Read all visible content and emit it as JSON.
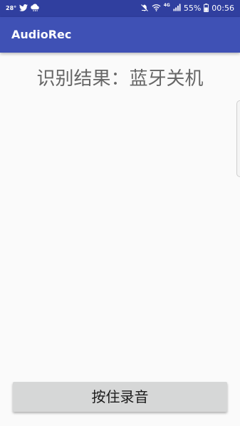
{
  "status_bar": {
    "temperature": "28°",
    "left_icons": [
      "twitter-icon",
      "cloud-rain-icon"
    ],
    "right_icons": [
      "mute-icon",
      "wifi-icon",
      "signal-icon",
      "battery-icon"
    ],
    "network_label": "4G",
    "battery_percent": "55%",
    "time": "00:56"
  },
  "app_bar": {
    "title": "AudioRec",
    "color": "#3f51b5",
    "status_color": "#303f9f"
  },
  "main": {
    "result_text": "识别结果：蓝牙关机"
  },
  "record_button": {
    "label": "按住录音"
  }
}
